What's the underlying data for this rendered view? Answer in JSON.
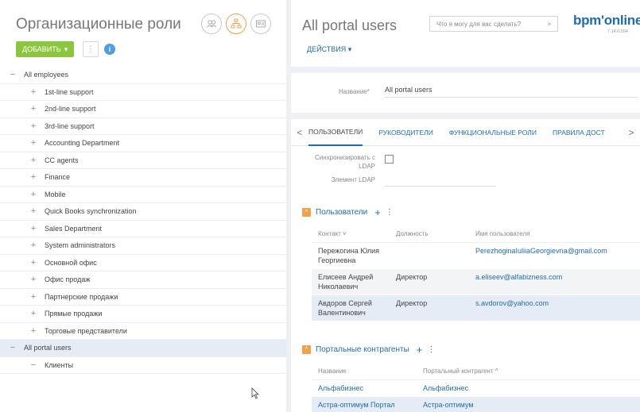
{
  "left_panel": {
    "title": "Организационные роли",
    "add_button": "ДОБАВИТЬ",
    "more_label": "⋮",
    "info_label": "i",
    "tree": [
      {
        "label": "All employees",
        "level": 0,
        "toggle": "−"
      },
      {
        "label": "1st-line support",
        "level": 1,
        "toggle": "+"
      },
      {
        "label": "2nd-line support",
        "level": 1,
        "toggle": "+"
      },
      {
        "label": "3rd-line support",
        "level": 1,
        "toggle": "+"
      },
      {
        "label": "Accounting Department",
        "level": 1,
        "toggle": "+"
      },
      {
        "label": "CC agents",
        "level": 1,
        "toggle": "+"
      },
      {
        "label": "Finance",
        "level": 1,
        "toggle": "+"
      },
      {
        "label": "Mobile",
        "level": 1,
        "toggle": "+"
      },
      {
        "label": "Quick Books synchronization",
        "level": 1,
        "toggle": "+"
      },
      {
        "label": "Sales Department",
        "level": 1,
        "toggle": "+"
      },
      {
        "label": "System administrators",
        "level": 1,
        "toggle": "+"
      },
      {
        "label": "Основной офис",
        "level": 1,
        "toggle": "+"
      },
      {
        "label": "Офис продаж",
        "level": 1,
        "toggle": "+"
      },
      {
        "label": "Партнерские продажи",
        "level": 1,
        "toggle": "+"
      },
      {
        "label": "Прямые продажи",
        "level": 1,
        "toggle": "+"
      },
      {
        "label": "Торговые представители",
        "level": 1,
        "toggle": "+"
      },
      {
        "label": "All portal users",
        "level": 0,
        "toggle": "−",
        "selected": true
      },
      {
        "label": "Клиенты",
        "level": 1,
        "toggle": "−"
      }
    ]
  },
  "header": {
    "record_title": "All portal users",
    "search_placeholder": "Что я могу для вас сделать?",
    "search_arrow": ">",
    "brand": "bpm'online",
    "version": "7.14.0.594",
    "actions": "ДЕЙСТВИЯ"
  },
  "name_field": {
    "label": "Название",
    "required_mark": "*",
    "value": "All portal users"
  },
  "tabs": {
    "left_arrow": "<",
    "right_arrow": ">",
    "items": [
      {
        "label": "ПОЛЬЗОВАТЕЛИ",
        "active": true
      },
      {
        "label": "РУКОВОДИТЕЛИ"
      },
      {
        "label": "ФУНКЦИОНАЛЬНЫЕ РОЛИ"
      },
      {
        "label": "ПРАВИЛА ДОСТ"
      }
    ]
  },
  "ldap": {
    "sync_label": "Синхронизировать с LDAP",
    "element_label": "Элемент LDAP"
  },
  "users_section": {
    "collapse": "^",
    "title": "Пользователи",
    "add": "+",
    "more": "⋮",
    "columns": [
      "Контакт ˅",
      "Должность",
      "Имя пользователя"
    ],
    "rows": [
      {
        "contact": "Пережогина Юлия Георгиевна",
        "position": "",
        "user": "PerezhoginaIuliiaGeorgievna@gmail.com"
      },
      {
        "contact": "Елисеев Андрей Николаевич",
        "position": "Директор",
        "user": "a.eliseev@alfabizness.com"
      },
      {
        "contact": "Авдоров Сергей Валентинович",
        "position": "Директор",
        "user": "s.avdorov@yahoo.com"
      }
    ]
  },
  "contractors_section": {
    "collapse": "^",
    "title": "Портальные контрагенты",
    "add": "+",
    "more": "⋮",
    "columns": [
      "Название",
      "Портальный контрагент ^"
    ],
    "rows": [
      {
        "name": "Альфабизнес",
        "account": "Альфабизнес"
      },
      {
        "name": "Астра-оптимум Портал",
        "account": "Астра-оптимум"
      }
    ]
  },
  "colors": {
    "accent": "#1f6cb1",
    "add_button": "#8cc63f",
    "orange": "#f0a34d",
    "selection": "#e6ecf6"
  }
}
